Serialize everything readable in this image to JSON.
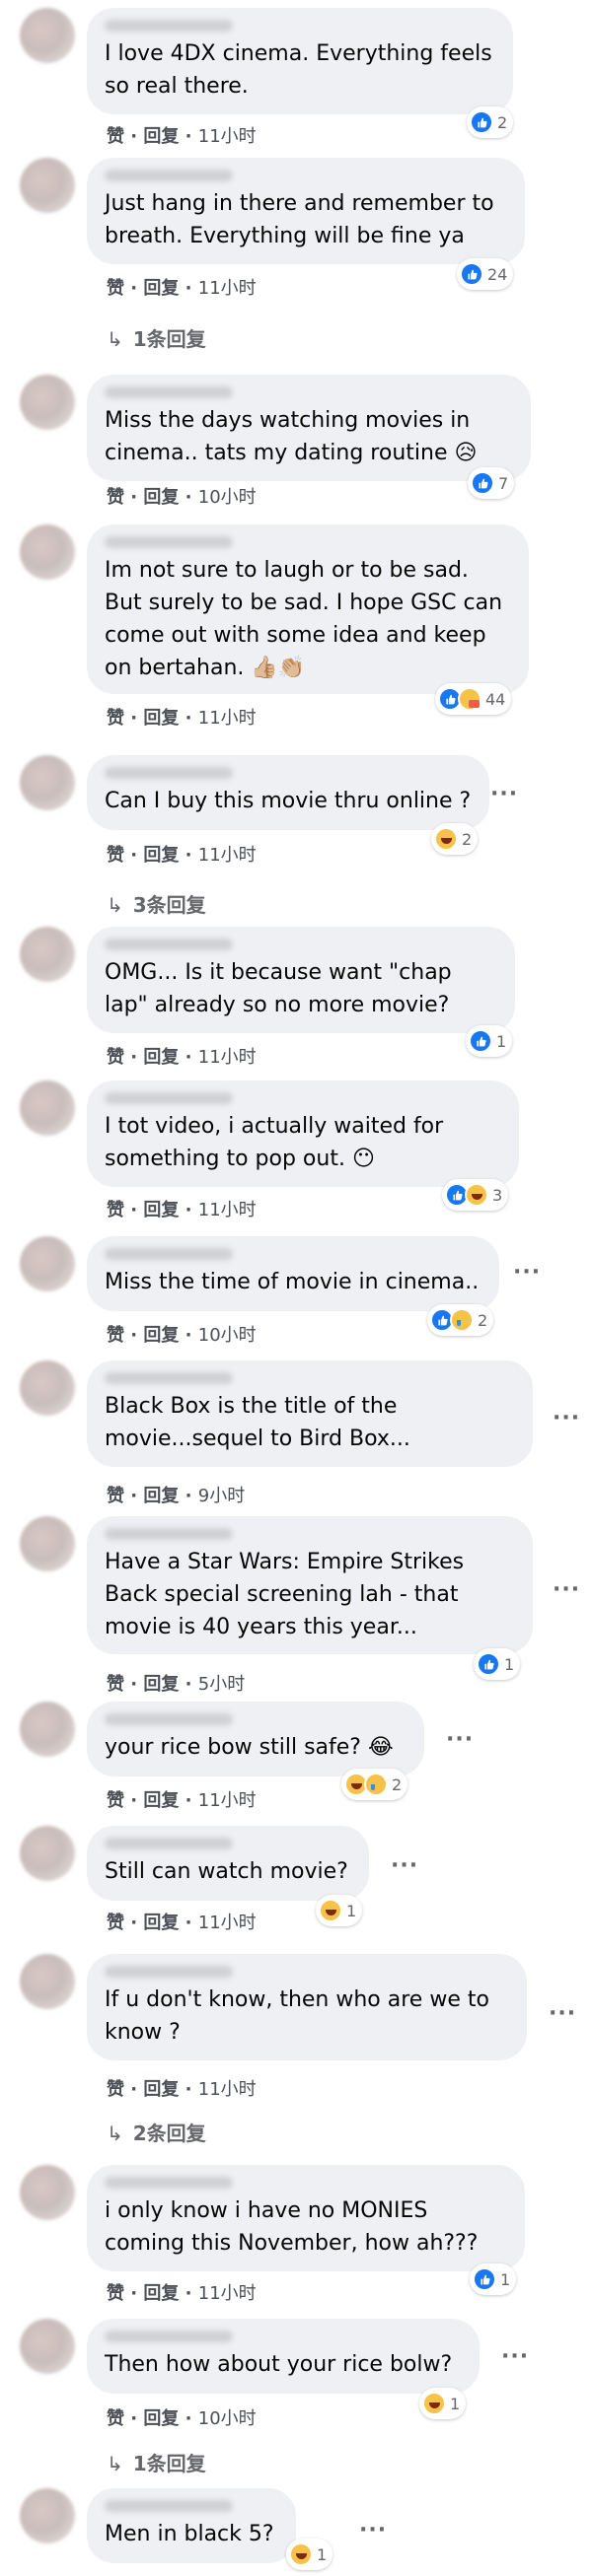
{
  "labels": {
    "like": "赞",
    "reply": "回复",
    "sep": "·"
  },
  "comments": [
    {
      "text": "I love 4DX cinema. Everything feels so real there.",
      "time": "11小时",
      "reactions": [
        "like"
      ],
      "count": "2"
    },
    {
      "text": "Just hang in there and remember to breath. Everything will be fine ya",
      "time": "11小时",
      "reactions": [
        "like"
      ],
      "count": "24",
      "replies": "1条回复"
    },
    {
      "text": "Miss the days watching movies in cinema.. tats my dating routine 😥",
      "time": "10小时",
      "reactions": [
        "like"
      ],
      "count": "7"
    },
    {
      "text": "Im not sure to laugh or to be sad. But surely to be sad. I hope GSC can come out with some idea and keep on bertahan. 👍🏼👏🏼",
      "time": "11小时",
      "reactions": [
        "like",
        "care"
      ],
      "count": "44"
    },
    {
      "text": "Can I buy this movie thru online ?",
      "time": "11小时",
      "reactions": [
        "haha"
      ],
      "count": "2",
      "replies": "3条回复"
    },
    {
      "text": "OMG... Is it because want \"chap lap\" already so no more movie?",
      "time": "11小时",
      "reactions": [
        "like"
      ],
      "count": "1"
    },
    {
      "text": "I tot video, i actually waited for something to pop out. 😶",
      "time": "11小时",
      "reactions": [
        "like",
        "haha"
      ],
      "count": "3"
    },
    {
      "text": "Miss the time of movie in cinema..",
      "time": "10小时",
      "reactions": [
        "like",
        "sad"
      ],
      "count": "2"
    },
    {
      "text": "Black Box is the title of the movie...sequel to Bird Box...",
      "time": "9小时"
    },
    {
      "text": "Have a Star Wars: Empire Strikes Back special screening lah - that movie is 40 years this year...",
      "time": "5小时",
      "reactions": [
        "like"
      ],
      "count": "1"
    },
    {
      "text": "your rice bow still safe? 😂",
      "time": "11小时",
      "reactions": [
        "haha",
        "sad"
      ],
      "count": "2"
    },
    {
      "text": "Still can watch movie?",
      "time": "11小时",
      "reactions": [
        "haha"
      ],
      "count": "1"
    },
    {
      "text": "If u don't know, then who are we to know ?",
      "time": "11小时",
      "replies": "2条回复"
    },
    {
      "text": "i only know i have no MONIES coming this November, how ah???",
      "time": "11小时",
      "reactions": [
        "like"
      ],
      "count": "1"
    },
    {
      "text": "Then how about your rice bolw?",
      "time": "10小时",
      "reactions": [
        "haha"
      ],
      "count": "1",
      "replies": "1条回复"
    },
    {
      "text": "Men in black 5?",
      "reactions": [
        "haha"
      ],
      "count": "1"
    }
  ]
}
